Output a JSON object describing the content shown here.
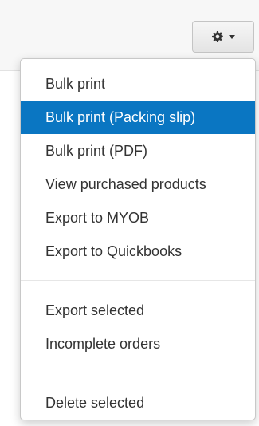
{
  "toolbar": {
    "settings_icon": "gear-icon",
    "dropdown_icon": "caret-down-icon"
  },
  "menu": {
    "group1": [
      {
        "label": "Bulk print"
      },
      {
        "label": "Bulk print (Packing slip)",
        "active": true
      },
      {
        "label": "Bulk print (PDF)"
      },
      {
        "label": "View purchased products"
      },
      {
        "label": "Export to MYOB"
      },
      {
        "label": "Export to Quickbooks"
      }
    ],
    "group2": [
      {
        "label": "Export selected"
      },
      {
        "label": "Incomplete orders"
      }
    ],
    "group3": [
      {
        "label": "Delete selected"
      }
    ]
  },
  "colors": {
    "highlight": "#0a76c2",
    "text": "#333333"
  }
}
